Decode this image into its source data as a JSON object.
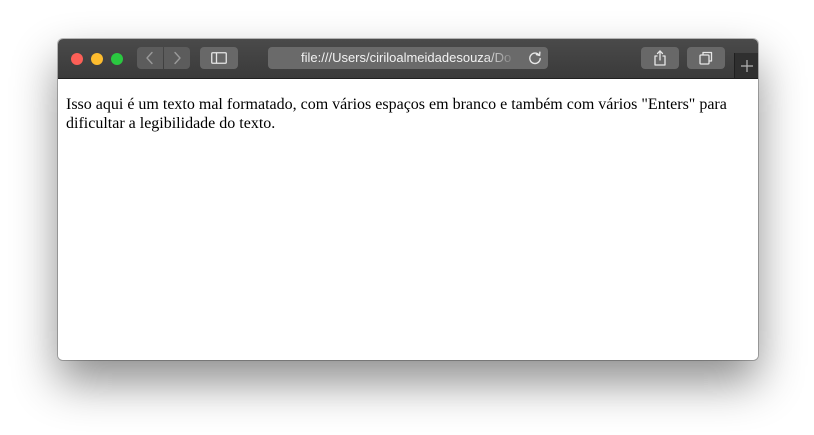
{
  "browser": {
    "address_bar": {
      "url": "file:///Users/ciriloalmeidadesouza/Do"
    },
    "icons": {
      "back": "chevron-left-icon",
      "forward": "chevron-right-icon",
      "sidebar": "sidebar-icon",
      "reload": "reload-icon",
      "share": "share-icon",
      "tabs": "tabs-overview-icon",
      "new_tab": "plus-icon"
    }
  },
  "page": {
    "body_text": "Isso aqui é um texto mal formatado, com vários espaços em branco e também com vários \"Enters\" para dificultar a legibilidade do texto."
  },
  "colors": {
    "toolbar": "#3f3f3f",
    "close": "#fc5f57",
    "minimize": "#fdbc2e",
    "maximize": "#2ac840"
  }
}
